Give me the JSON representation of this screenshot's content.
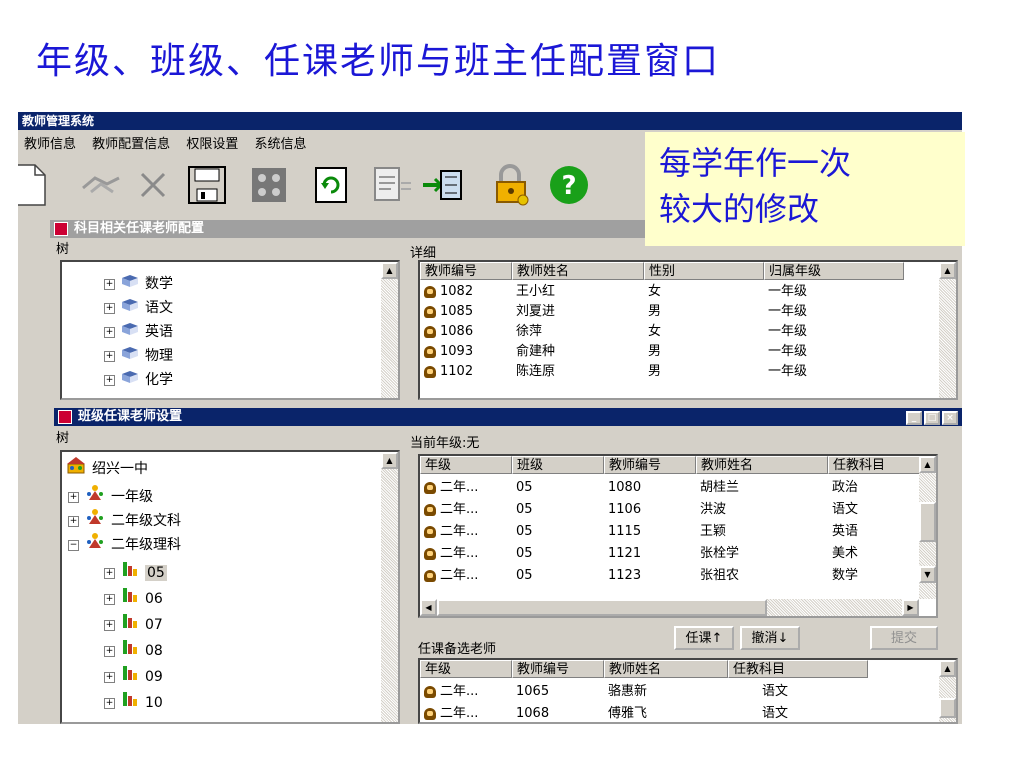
{
  "slide": {
    "title": "年级、班级、任课老师与班主任配置窗口",
    "note_line1": "每学年作一次",
    "note_line2": "较大的修改"
  },
  "app": {
    "title": "教师管理系统",
    "menu": [
      "教师信息",
      "教师配置信息",
      "权限设置",
      "系统信息"
    ],
    "toolbar_icons": [
      "new-icon",
      "handshake-icon",
      "delete-icon",
      "save-icon",
      "people-icon",
      "refresh-icon",
      "report-icon",
      "exit-icon",
      "lock-icon",
      "help-icon"
    ],
    "help_glyph": "?",
    "help_color": "#19a019"
  },
  "subject_window": {
    "title": "科目相关任课老师配置",
    "tree_label": "树",
    "detail_label": "详细",
    "tree": [
      "数学",
      "语文",
      "英语",
      "物理",
      "化学"
    ],
    "columns": [
      "教师编号",
      "教师姓名",
      "性别",
      "归属年级"
    ],
    "rows": [
      [
        "1082",
        "王小红",
        "女",
        "一年级"
      ],
      [
        "1085",
        "刘夏进",
        "男",
        "一年级"
      ],
      [
        "1086",
        "徐萍",
        "女",
        "一年级"
      ],
      [
        "1093",
        "俞建种",
        "男",
        "一年级"
      ],
      [
        "1102",
        "陈连原",
        "男",
        "一年级"
      ]
    ]
  },
  "class_window": {
    "title": "班级任课老师设置",
    "tree_label": "树",
    "current_grade_label": "当前年级:无",
    "tree_root": "绍兴一中",
    "grades": [
      "一年级",
      "二年级文科",
      "二年级理科"
    ],
    "classes": [
      "05",
      "06",
      "07",
      "08",
      "09",
      "10"
    ],
    "columns": [
      "年级",
      "班级",
      "教师编号",
      "教师姓名",
      "任教科目"
    ],
    "rows": [
      [
        "二年...",
        "05",
        "1080",
        "胡桂兰",
        "政治"
      ],
      [
        "二年...",
        "05",
        "1106",
        "洪波",
        "语文"
      ],
      [
        "二年...",
        "05",
        "1115",
        "王颖",
        "英语"
      ],
      [
        "二年...",
        "05",
        "1121",
        "张栓学",
        "美术"
      ],
      [
        "二年...",
        "05",
        "1123",
        "张祖农",
        "数学"
      ]
    ],
    "candidate_label": "任课备选老师",
    "btn_assign": "任课↑",
    "btn_cancel": "撤消↓",
    "btn_submit": "提交",
    "candidate_columns": [
      "年级",
      "教师编号",
      "教师姓名",
      "任教科目"
    ],
    "candidate_rows": [
      [
        "二年...",
        "1065",
        "骆惠新",
        "语文"
      ],
      [
        "二年...",
        "1068",
        "傅雅飞",
        "语文"
      ]
    ],
    "win_buttons": [
      "_",
      "□",
      "×"
    ]
  },
  "colors": {
    "title_blue": "#1b17d6",
    "note_bg": "#ffffcc",
    "titlebar_active": "#0a246a",
    "window_face": "#d4d0c8"
  }
}
